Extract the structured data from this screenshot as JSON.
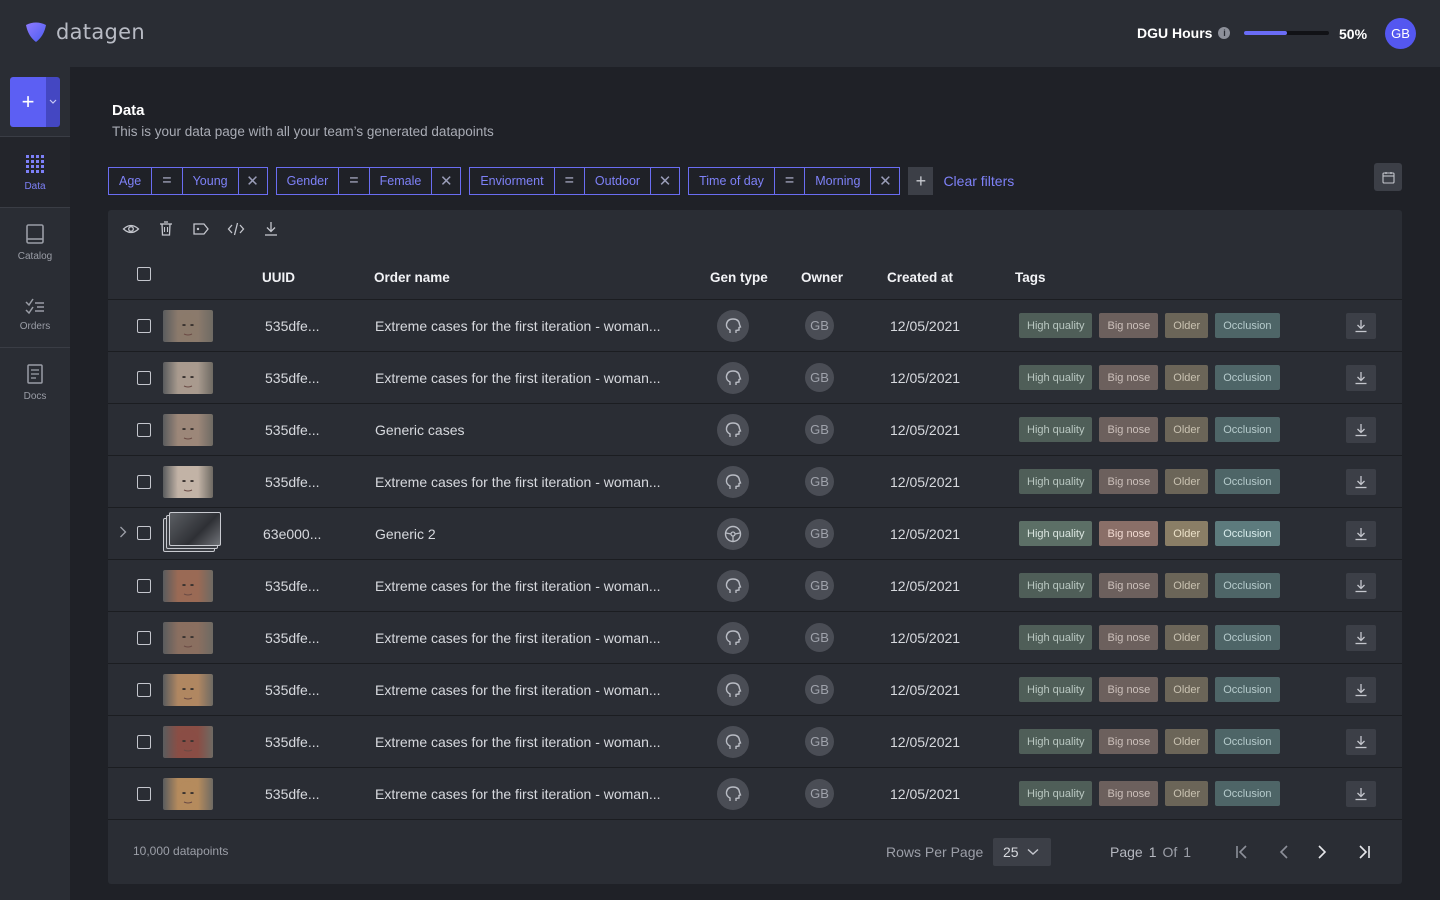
{
  "app": {
    "name": "datagen"
  },
  "header": {
    "dgu_label": "DGU Hours",
    "dgu_info_icon": "info-icon",
    "dgu_progress": 0.5,
    "dgu_percent": "50%",
    "avatar_initials": "GB"
  },
  "sidebar": {
    "new_button_icon": "plus-icon",
    "items": [
      {
        "label": "Data",
        "icon": "data-grid-icon",
        "active": true
      },
      {
        "label": "Catalog",
        "icon": "book-icon",
        "active": false
      },
      {
        "label": "Orders",
        "icon": "orders-icon",
        "active": false
      },
      {
        "label": "Docs",
        "icon": "docs-icon",
        "active": false
      }
    ]
  },
  "page": {
    "title": "Data",
    "subtitle": "This is your data page with all your team’s generated datapoints"
  },
  "filters": [
    {
      "field": "Age",
      "operator": "=",
      "value": "Young"
    },
    {
      "field": "Gender",
      "operator": "=",
      "value": "Female"
    },
    {
      "field": "Enviorment",
      "operator": "=",
      "value": "Outdoor"
    },
    {
      "field": "Time of day",
      "operator": "=",
      "value": "Morning"
    }
  ],
  "clear_filters_label": "Clear filters",
  "table": {
    "columns": [
      "UUID",
      "Order name",
      "Gen type",
      "Owner",
      "Created at",
      "Tags"
    ],
    "rows": [
      {
        "uuid": "535dfe...",
        "order_name": "Extreme cases for the first iteration - woman...",
        "owner": "GB",
        "created_at": "12/05/2021",
        "tags": [
          "High quality",
          "Big nose",
          "Older",
          "Occlusion"
        ]
      },
      {
        "uuid": "535dfe...",
        "order_name": "Extreme cases for the first iteration - woman...",
        "owner": "GB",
        "created_at": "12/05/2021",
        "tags": [
          "High quality",
          "Big nose",
          "Older",
          "Occlusion"
        ]
      },
      {
        "uuid": "535dfe...",
        "order_name": "Generic cases",
        "owner": "GB",
        "created_at": "12/05/2021",
        "tags": [
          "High quality",
          "Big nose",
          "Older",
          "Occlusion"
        ]
      },
      {
        "uuid": "535dfe...",
        "order_name": "Extreme cases for the first iteration - woman...",
        "owner": "GB",
        "created_at": "12/05/2021",
        "tags": [
          "High quality",
          "Big nose",
          "Older",
          "Occlusion"
        ]
      },
      {
        "uuid": "63e000...",
        "order_name": "Generic 2",
        "owner": "GB",
        "created_at": "12/05/2021",
        "tags": [
          "High quality",
          "Big nose",
          "Older",
          "Occlusion"
        ]
      },
      {
        "uuid": "535dfe...",
        "order_name": "Extreme cases for the first iteration - woman...",
        "owner": "GB",
        "created_at": "12/05/2021",
        "tags": [
          "High quality",
          "Big nose",
          "Older",
          "Occlusion"
        ]
      },
      {
        "uuid": "535dfe...",
        "order_name": "Extreme cases for the first iteration - woman...",
        "owner": "GB",
        "created_at": "12/05/2021",
        "tags": [
          "High quality",
          "Big nose",
          "Older",
          "Occlusion"
        ]
      },
      {
        "uuid": "535dfe...",
        "order_name": "Extreme cases for the first iteration - woman...",
        "owner": "GB",
        "created_at": "12/05/2021",
        "tags": [
          "High quality",
          "Big nose",
          "Older",
          "Occlusion"
        ]
      },
      {
        "uuid": "535dfe...",
        "order_name": "Extreme cases for the first iteration - woman...",
        "owner": "GB",
        "created_at": "12/05/2021",
        "tags": [
          "High quality",
          "Big nose",
          "Older",
          "Occlusion"
        ]
      },
      {
        "uuid": "535dfe...",
        "order_name": "Extreme cases for the first iteration - woman...",
        "owner": "GB",
        "created_at": "12/05/2021",
        "tags": [
          "High quality",
          "Big nose",
          "Older",
          "Occlusion"
        ]
      }
    ]
  },
  "footer": {
    "count": "10,000 datapoints",
    "rows_per_page_label": "Rows Per Page",
    "rows_per_page_value": "25",
    "page_label": "Page",
    "page_current": "1",
    "of_label": "Of",
    "page_total": "1"
  },
  "colors": {
    "accent": "#5c5ff3",
    "background": "#1f2127",
    "panel": "#2a2d34"
  }
}
